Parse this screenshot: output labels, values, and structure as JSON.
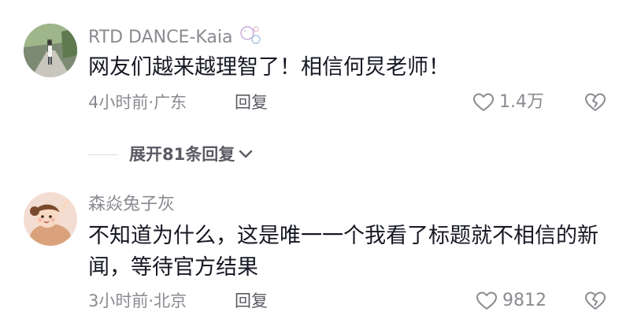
{
  "comments": [
    {
      "username": "RTD DANCE-Kaia",
      "username_icon": "bubbles-icon",
      "content": "网友们越来越理智了！相信何炅老师！",
      "time": "4小时前",
      "separator": "·",
      "location": "广东",
      "reply_label": "回复",
      "like_count": "1.4万"
    },
    {
      "username": "森焱兔子灰",
      "content": "不知道为什么，这是唯一一个我看了标题就不相信的新闻，等待官方结果",
      "time": "3小时前",
      "separator": "·",
      "location": "北京",
      "reply_label": "回复",
      "like_count": "9812"
    }
  ],
  "expand_replies": {
    "label": "展开81条回复"
  },
  "colors": {
    "text_primary": "#161823",
    "text_secondary": "#8a8b91",
    "action_text": "#5a5b63"
  }
}
